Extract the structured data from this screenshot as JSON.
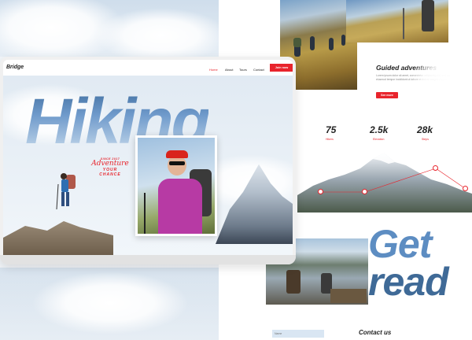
{
  "right_page": {
    "guided_title": "Guided adventures",
    "lorem": "Lorem ipsum dolor sit amet, consectetur adipiscing elit, sed do eiusmod tempor incididunt ut labore et dolore magna aliqua.",
    "button_label": "See more",
    "stats": [
      {
        "value": "75",
        "label": "Hikers"
      },
      {
        "value": "2.5k",
        "label": "Elevation"
      },
      {
        "value": "28k",
        "label": "Steps"
      }
    ],
    "get_text": "Get",
    "ready_text": "read",
    "contact_title": "Contact us",
    "name_placeholder": "Name"
  },
  "laptop": {
    "brand": "Bridge",
    "nav": [
      "Home",
      "About",
      "Tours",
      "Contact"
    ],
    "signup_label": "Join now",
    "hero_text": "Hiking",
    "badge": {
      "line1": "SINCE 2017",
      "line2": "Adventure",
      "line3": "YOUR CHANCE"
    }
  },
  "colors": {
    "accent": "#e8242c",
    "sky": "#6f9acb",
    "text": "#222222"
  },
  "icons": {
    "marker": "map-marker-circle"
  }
}
